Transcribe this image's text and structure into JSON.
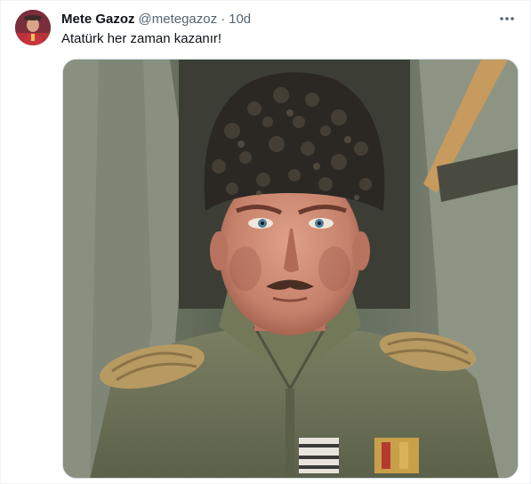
{
  "tweet": {
    "author": {
      "display_name": "Mete Gazoz",
      "handle": "@metegazoz"
    },
    "separator": "·",
    "time": "10d",
    "text": "Atatürk her zaman kazanır!",
    "more_icon": "more-horizontal-icon",
    "media": {
      "kind": "photo"
    }
  },
  "colors": {
    "text_primary": "#0f1419",
    "text_secondary": "#536471",
    "border": "#cfd9de"
  }
}
